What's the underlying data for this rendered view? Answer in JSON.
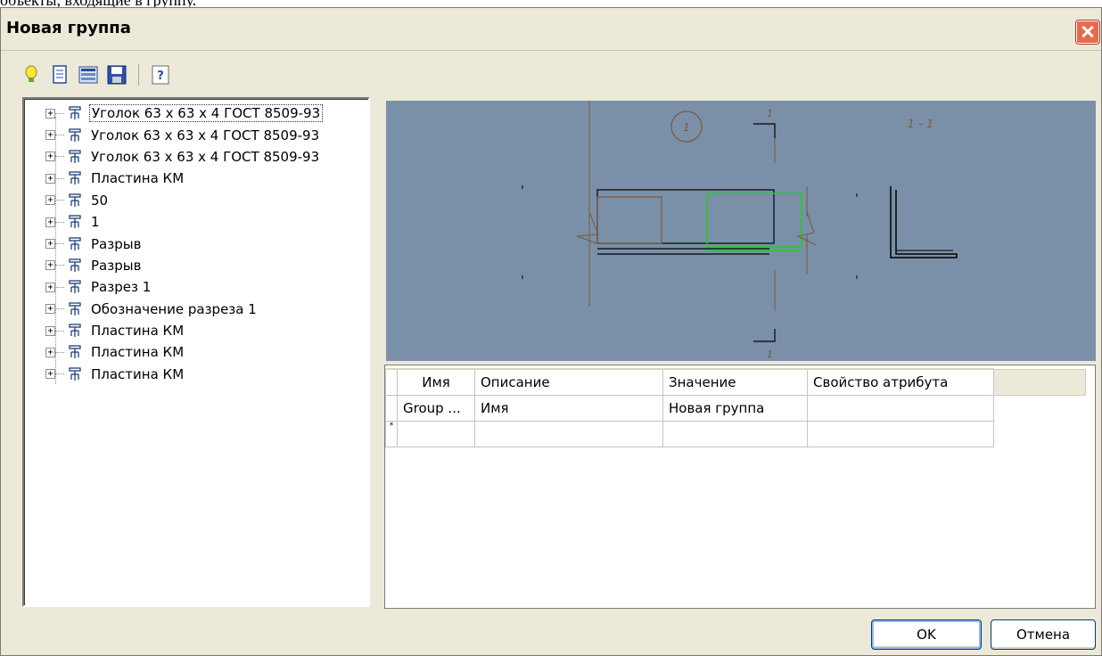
{
  "background_caption": "объекты, входящие в группу.",
  "window": {
    "title": "Новая группа"
  },
  "toolbar": {
    "buttons": [
      {
        "icon": "lightbulb-icon"
      },
      {
        "icon": "document-icon"
      },
      {
        "icon": "properties-icon"
      },
      {
        "icon": "save-icon"
      },
      {
        "icon": "help-icon"
      }
    ]
  },
  "tree": {
    "items": [
      {
        "label": "Уголок 63 х 63 х 4 ГОСТ 8509-93",
        "selected": true
      },
      {
        "label": "Уголок 63 х 63 х 4 ГОСТ 8509-93"
      },
      {
        "label": "Уголок 63 х 63 х 4 ГОСТ 8509-93"
      },
      {
        "label": "Пластина КМ"
      },
      {
        "label": "50"
      },
      {
        "label": "1"
      },
      {
        "label": "Разрыв"
      },
      {
        "label": "Разрыв"
      },
      {
        "label": "Разрез 1"
      },
      {
        "label": "Обозначение разреза  1"
      },
      {
        "label": "Пластина КМ"
      },
      {
        "label": "Пластина КМ"
      },
      {
        "label": "Пластина КМ"
      }
    ]
  },
  "preview": {
    "callout_number": "1",
    "section_mark_top": "1",
    "section_mark_bottom": "1",
    "section_title": "1 – 1",
    "colors": {
      "background": "#7a90a8",
      "outline": "#000000",
      "highlight": "#22cc22",
      "annotation": "#7a5a3a"
    }
  },
  "grid": {
    "columns": [
      "Имя",
      "Описание",
      "Значение",
      "Свойство атрибута"
    ],
    "rows": [
      [
        "Group ...",
        "Имя",
        "Новая группа",
        ""
      ]
    ],
    "new_row_marker": "*"
  },
  "buttons": {
    "ok": "OK",
    "cancel": "Отмена"
  }
}
